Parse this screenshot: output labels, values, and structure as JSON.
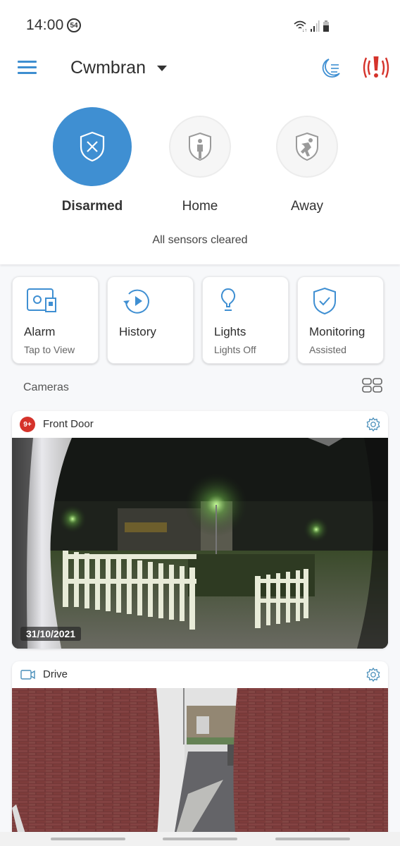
{
  "status_bar": {
    "time": "14:00",
    "notification_badge": "54",
    "icons": [
      "wifi-icon",
      "signal-icon",
      "battery-icon"
    ]
  },
  "app_bar": {
    "menu_icon": "hamburger-menu-icon",
    "location": "Cwmbran",
    "location_icon": "caret-down-icon",
    "night_mode_icon": "moon-list-icon",
    "panic_icon": "alarm-alert-icon",
    "accent_color": "#3f8fd2",
    "panic_color": "#d5332b"
  },
  "modes": [
    {
      "label": "Disarmed",
      "icon": "shield-x-icon",
      "active": true
    },
    {
      "label": "Home",
      "icon": "shield-person-icon",
      "active": false
    },
    {
      "label": "Away",
      "icon": "shield-running-icon",
      "active": false
    }
  ],
  "sensor_status": "All sensors cleared",
  "actions": [
    {
      "title": "Alarm",
      "subtitle": "Tap to View",
      "icon": "alarm-panel-icon"
    },
    {
      "title": "History",
      "subtitle": "",
      "icon": "history-play-icon"
    },
    {
      "title": "Lights",
      "subtitle": "Lights Off",
      "icon": "lightbulb-icon"
    },
    {
      "title": "Monitoring",
      "subtitle": "Assisted",
      "icon": "shield-check-icon"
    }
  ],
  "cameras": {
    "section_title": "Cameras",
    "layout_icon": "grid-view-icon",
    "items": [
      {
        "name": "Front Door",
        "badge": "9+",
        "date": "31/10/2021",
        "settings_icon": "gear-icon",
        "scene": "night"
      },
      {
        "name": "Drive",
        "badge": "",
        "date": "",
        "settings_icon": "gear-icon",
        "scene": "day",
        "type_icon": "video-camera-icon"
      }
    ]
  }
}
